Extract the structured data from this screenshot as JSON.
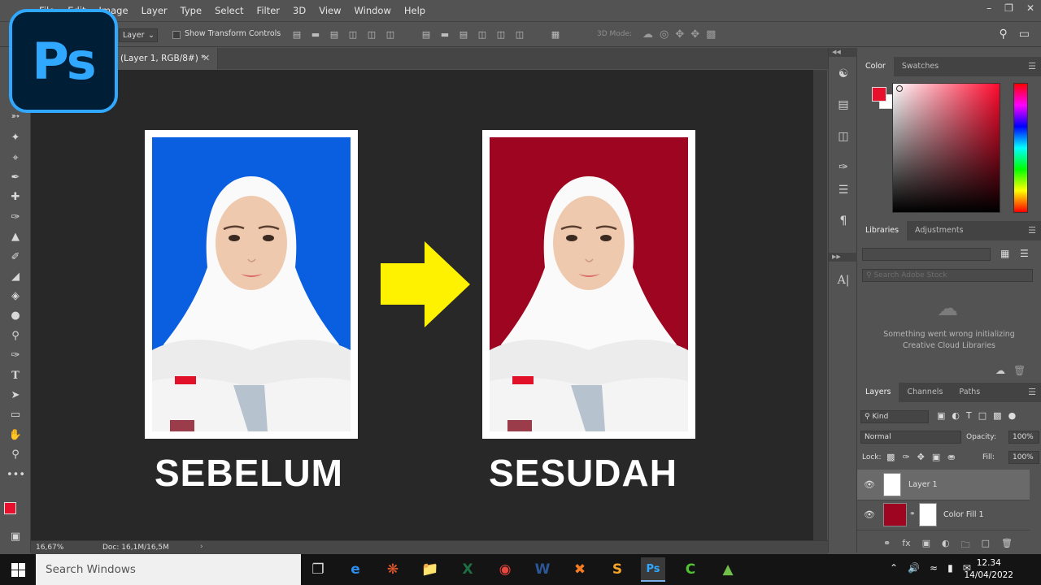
{
  "app": {
    "logo_text": "Ps"
  },
  "menubar": {
    "items": [
      "File",
      "Edit",
      "Image",
      "Layer",
      "Type",
      "Select",
      "Filter",
      "3D",
      "View",
      "Window",
      "Help"
    ]
  },
  "options_bar": {
    "auto_select_value": "Layer",
    "show_transform_label": "Show Transform Controls",
    "mode_3d_label": "3D Mode:"
  },
  "document": {
    "tab_title": "(Layer 1, RGB/8#) *",
    "zoom": "16,67%",
    "doc_size": "Doc: 16,1M/16,5M"
  },
  "canvas": {
    "before_label": "SEBELUM",
    "after_label": "SESUDAH",
    "before_bg_color": "#0a5fe0",
    "after_bg_color": "#9e0520",
    "arrow_color": "#fff200"
  },
  "panels": {
    "color_tabs": [
      "Color",
      "Swatches"
    ],
    "foreground_color": "#e8112d",
    "libraries_tabs": [
      "Libraries",
      "Adjustments"
    ],
    "libraries_search_placeholder": "Search Adobe Stock",
    "libraries_error": "Something went wrong initializing Creative Cloud Libraries",
    "layers_tabs": [
      "Layers",
      "Channels",
      "Paths"
    ],
    "kind_filter": "Kind",
    "blend_mode": "Normal",
    "opacity_label": "Opacity:",
    "opacity_value": "100%",
    "lock_label": "Lock:",
    "fill_label": "Fill:",
    "fill_value": "100%",
    "layers": [
      {
        "name": "Layer 1"
      },
      {
        "name": "Color Fill 1"
      }
    ]
  },
  "taskbar": {
    "search_placeholder": "Search Windows",
    "time": "12.34",
    "date": "14/04/2022"
  }
}
